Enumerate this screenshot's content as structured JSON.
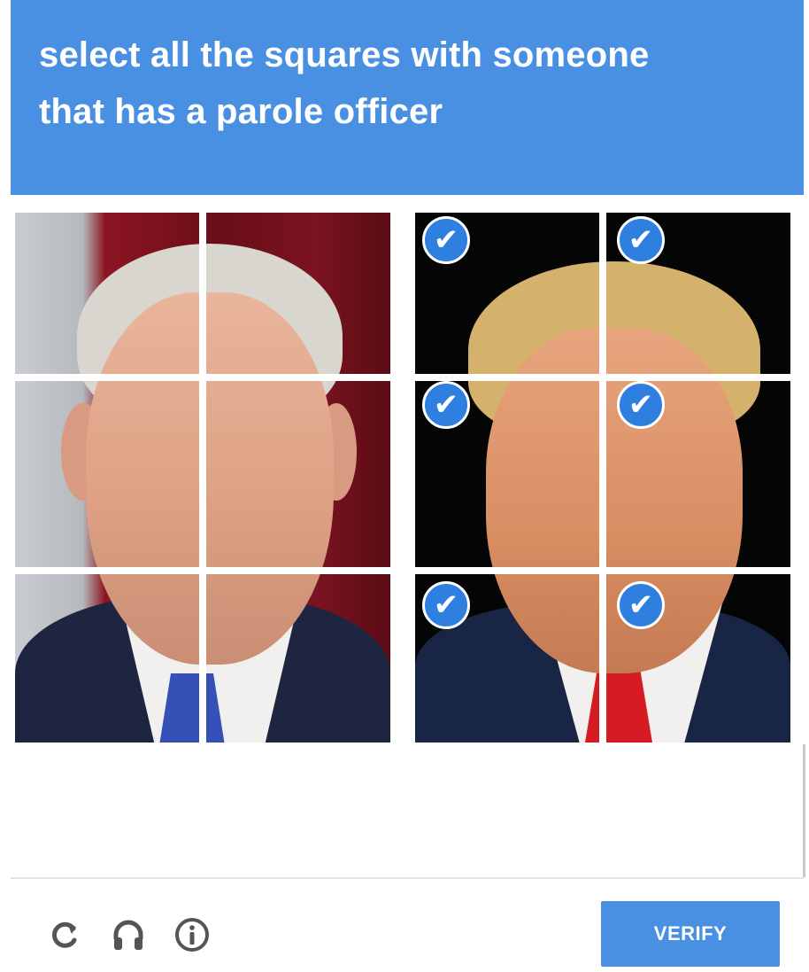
{
  "header": {
    "prompt_line1": "select all the squares with someone",
    "prompt_line2": "that has a parole officer"
  },
  "grid": {
    "left_image": {
      "tiles": [
        {
          "row": 1,
          "col": 1,
          "selected": false
        },
        {
          "row": 1,
          "col": 2,
          "selected": false
        },
        {
          "row": 2,
          "col": 1,
          "selected": false
        },
        {
          "row": 2,
          "col": 2,
          "selected": false
        },
        {
          "row": 3,
          "col": 1,
          "selected": false
        },
        {
          "row": 3,
          "col": 2,
          "selected": false
        }
      ]
    },
    "right_image": {
      "tiles": [
        {
          "row": 1,
          "col": 1,
          "selected": true
        },
        {
          "row": 1,
          "col": 2,
          "selected": true
        },
        {
          "row": 2,
          "col": 1,
          "selected": true
        },
        {
          "row": 2,
          "col": 2,
          "selected": true
        },
        {
          "row": 3,
          "col": 1,
          "selected": true
        },
        {
          "row": 3,
          "col": 2,
          "selected": true
        }
      ]
    },
    "check_glyph": "✔"
  },
  "footer": {
    "icons": [
      "reload-icon",
      "headphones-icon",
      "info-icon"
    ],
    "verify_label": "VERIFY"
  },
  "colors": {
    "header_bg": "#4a90e2",
    "check_bg": "#2f7fe0",
    "verify_bg": "#4a90e2"
  }
}
